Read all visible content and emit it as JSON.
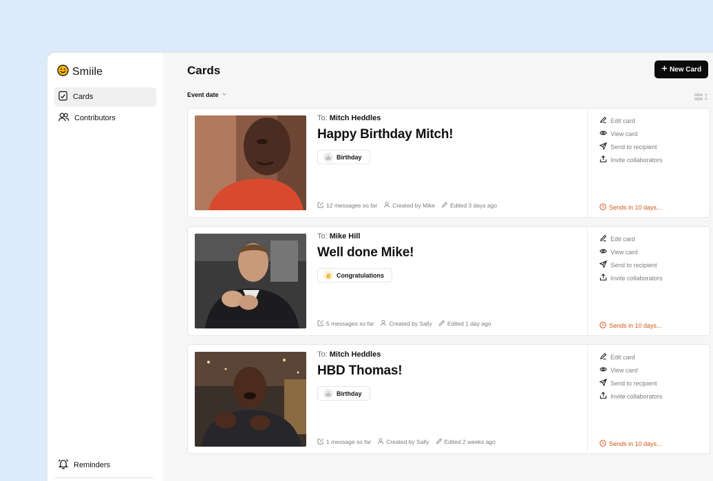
{
  "app": {
    "name": "Smiile"
  },
  "sidebar": {
    "items": [
      {
        "label": "Cards",
        "icon": "cards-icon",
        "active": true
      },
      {
        "label": "Contributors",
        "icon": "users-icon",
        "active": false
      }
    ],
    "footer": {
      "label": "Reminders",
      "icon": "bell-icon"
    }
  },
  "header": {
    "title": "Cards",
    "new_card_label": "New Card",
    "sort_label": "Event date"
  },
  "card_actions": {
    "edit": "Edit card",
    "view": "View card",
    "send": "Send to recipient",
    "invite": "Invite collaborators"
  },
  "cards": [
    {
      "to_prefix": "To:",
      "recipient": "Mitch Heddles",
      "title": "Happy Birthday Mitch!",
      "tag": "Birthday",
      "tag_icon": "cake-icon",
      "messages": "12 messages so far",
      "created_by": "Created by Mike",
      "edited": "Edited 3 days ago",
      "sends": "Sends in 10 days..."
    },
    {
      "to_prefix": "To:",
      "recipient": "Mike Hill",
      "title": "Well done Mike!",
      "tag": "Congratulations",
      "tag_icon": "clap-icon",
      "messages": "5 messages so far",
      "created_by": "Created by Sally",
      "edited": "Edited 1 day ago",
      "sends": "Sends in 10 days..."
    },
    {
      "to_prefix": "To:",
      "recipient": "Mitch Heddles",
      "title": "HBD Thomas!",
      "tag": "Birthday",
      "tag_icon": "cake-icon",
      "messages": "1 message so far",
      "created_by": "Created by Sally",
      "edited": "Edited 2 weeks ago",
      "sends": "Sends in 10 days..."
    }
  ],
  "colors": {
    "background": "#dcebf9",
    "accent": "#0b0b0b",
    "sends_warning": "#d3541a",
    "logo": "#f5b400"
  }
}
